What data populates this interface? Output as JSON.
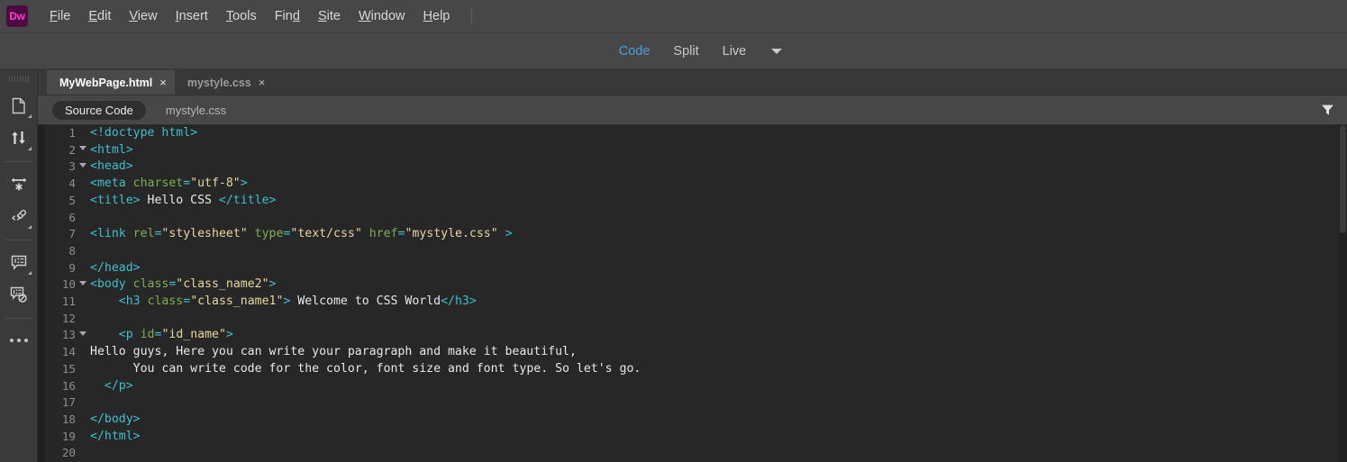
{
  "app": {
    "logo_text": "Dw",
    "logo_bg": "#4b0a40",
    "logo_fg": "#ff3bd4"
  },
  "menubar": {
    "items": [
      {
        "label": "File",
        "mnemonic": "F"
      },
      {
        "label": "Edit",
        "mnemonic": "E"
      },
      {
        "label": "View",
        "mnemonic": "V"
      },
      {
        "label": "Insert",
        "mnemonic": "I"
      },
      {
        "label": "Tools",
        "mnemonic": "T"
      },
      {
        "label": "Find",
        "mnemonic": "d"
      },
      {
        "label": "Site",
        "mnemonic": "S"
      },
      {
        "label": "Window",
        "mnemonic": "W"
      },
      {
        "label": "Help",
        "mnemonic": "H"
      }
    ]
  },
  "viewbar": {
    "buttons": [
      {
        "label": "Code",
        "active": true
      },
      {
        "label": "Split",
        "active": false
      },
      {
        "label": "Live",
        "active": false
      }
    ],
    "dropdown_icon": "chevron-down-icon",
    "active_color": "#4a9eda"
  },
  "rail": {
    "items": [
      {
        "name": "open-documents-icon",
        "flyout": true
      },
      {
        "name": "file-transfer-icon",
        "flyout": true
      },
      {
        "name": "format-source-code-icon",
        "flyout": false
      },
      {
        "name": "apply-source-format-icon",
        "flyout": true
      },
      {
        "name": "apply-comment-icon",
        "flyout": true
      },
      {
        "name": "remove-comment-icon",
        "flyout": false
      },
      {
        "name": "more-options-icon",
        "flyout": false
      }
    ]
  },
  "doctabs": {
    "tabs": [
      {
        "label": "MyWebPage.html",
        "active": true,
        "close": "×"
      },
      {
        "label": "mystyle.css",
        "active": false,
        "close": "×"
      }
    ]
  },
  "subbar": {
    "source_code_label": "Source Code",
    "stylesheet_label": "mystyle.css",
    "filter_icon": "filter-funnel-icon"
  },
  "editor": {
    "language": "html",
    "first_line": 1,
    "last_line": 20,
    "lines": [
      {
        "n": "1",
        "fold": false,
        "indent": 0,
        "tokens": [
          {
            "t": "tg",
            "v": "<!doctype html>"
          }
        ]
      },
      {
        "n": "2",
        "fold": true,
        "indent": 0,
        "tokens": [
          {
            "t": "tg",
            "v": "<html>"
          }
        ]
      },
      {
        "n": "3",
        "fold": true,
        "indent": 0,
        "tokens": [
          {
            "t": "tg",
            "v": "<head>"
          }
        ]
      },
      {
        "n": "4",
        "fold": false,
        "indent": 0,
        "tokens": [
          {
            "t": "tg",
            "v": "<meta "
          },
          {
            "t": "at",
            "v": "charset"
          },
          {
            "t": "tg",
            "v": "="
          },
          {
            "t": "st",
            "v": "\"utf-8\""
          },
          {
            "t": "tg",
            "v": ">"
          }
        ]
      },
      {
        "n": "5",
        "fold": false,
        "indent": 0,
        "tokens": [
          {
            "t": "tg",
            "v": "<title>"
          },
          {
            "t": "tx",
            "v": " Hello CSS "
          },
          {
            "t": "tg",
            "v": "</title>"
          }
        ]
      },
      {
        "n": "6",
        "fold": false,
        "indent": 0,
        "tokens": []
      },
      {
        "n": "7",
        "fold": false,
        "indent": 0,
        "tokens": [
          {
            "t": "tg",
            "v": "<link "
          },
          {
            "t": "at",
            "v": "rel"
          },
          {
            "t": "tg",
            "v": "="
          },
          {
            "t": "st",
            "v": "\"stylesheet\""
          },
          {
            "t": "tg",
            "v": " "
          },
          {
            "t": "at",
            "v": "type"
          },
          {
            "t": "tg",
            "v": "="
          },
          {
            "t": "st",
            "v": "\"text/css\""
          },
          {
            "t": "tg",
            "v": " "
          },
          {
            "t": "at",
            "v": "href"
          },
          {
            "t": "tg",
            "v": "="
          },
          {
            "t": "st",
            "v": "\"mystyle.css\""
          },
          {
            "t": "tg",
            "v": " >"
          }
        ]
      },
      {
        "n": "8",
        "fold": false,
        "indent": 0,
        "tokens": []
      },
      {
        "n": "9",
        "fold": false,
        "indent": 0,
        "tokens": [
          {
            "t": "tg",
            "v": "</head>"
          }
        ]
      },
      {
        "n": "10",
        "fold": true,
        "indent": 0,
        "tokens": [
          {
            "t": "tg",
            "v": "<body "
          },
          {
            "t": "at",
            "v": "class"
          },
          {
            "t": "tg",
            "v": "="
          },
          {
            "t": "st",
            "v": "\"class_name2\""
          },
          {
            "t": "tg",
            "v": ">"
          }
        ]
      },
      {
        "n": "11",
        "fold": false,
        "indent": 4,
        "tokens": [
          {
            "t": "tg",
            "v": "<h3 "
          },
          {
            "t": "at",
            "v": "class"
          },
          {
            "t": "tg",
            "v": "="
          },
          {
            "t": "st",
            "v": "\"class_name1\""
          },
          {
            "t": "tg",
            "v": ">"
          },
          {
            "t": "tx",
            "v": " Welcome to CSS World"
          },
          {
            "t": "tg",
            "v": "</h3>"
          }
        ]
      },
      {
        "n": "12",
        "fold": false,
        "indent": 0,
        "tokens": []
      },
      {
        "n": "13",
        "fold": true,
        "indent": 4,
        "tokens": [
          {
            "t": "tg",
            "v": "<p "
          },
          {
            "t": "at",
            "v": "id"
          },
          {
            "t": "tg",
            "v": "="
          },
          {
            "t": "st",
            "v": "\"id_name\""
          },
          {
            "t": "tg",
            "v": ">"
          }
        ]
      },
      {
        "n": "14",
        "fold": false,
        "indent": 0,
        "tokens": [
          {
            "t": "tx",
            "v": "Hello guys, Here you can write your paragraph and make it beautiful,"
          }
        ]
      },
      {
        "n": "15",
        "fold": false,
        "indent": 4,
        "tokens": [
          {
            "t": "tx",
            "v": "  You can write code for the color, font size and font type. So let's go."
          }
        ]
      },
      {
        "n": "16",
        "fold": false,
        "indent": 2,
        "tokens": [
          {
            "t": "tg",
            "v": "</p>"
          }
        ]
      },
      {
        "n": "17",
        "fold": false,
        "indent": 0,
        "tokens": []
      },
      {
        "n": "18",
        "fold": false,
        "indent": 0,
        "tokens": [
          {
            "t": "tg",
            "v": "</body>"
          }
        ]
      },
      {
        "n": "19",
        "fold": false,
        "indent": 0,
        "tokens": [
          {
            "t": "tg",
            "v": "</html>"
          }
        ]
      },
      {
        "n": "20",
        "fold": false,
        "indent": 0,
        "tokens": []
      }
    ],
    "colors": {
      "background": "#272727",
      "tag": "#3fbfcf",
      "attribute": "#7fae52",
      "string": "#e8d6a0",
      "text": "#e8e8e8",
      "line_number": "#8d8d8d"
    }
  }
}
